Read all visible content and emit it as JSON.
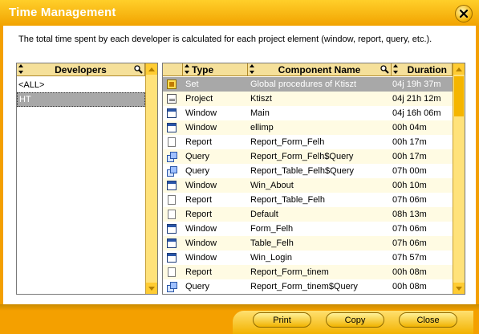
{
  "window": {
    "title": "Time Management",
    "description": "The total time spent by each developer is calculated for each project element (window, report, query, etc.)."
  },
  "developers": {
    "header": "Developers",
    "items": [
      {
        "label": "<ALL>",
        "selected": false
      },
      {
        "label": "HT",
        "selected": true
      }
    ]
  },
  "grid": {
    "columns": {
      "type": "Type",
      "component": "Component Name",
      "duration": "Duration"
    },
    "rows": [
      {
        "icon": "set-icon",
        "type": "Set",
        "component": "Global procedures of Ktiszt",
        "duration": "04j 19h 37m",
        "selected": true
      },
      {
        "icon": "project-icon",
        "type": "Project",
        "component": "Ktiszt",
        "duration": "04j 21h 12m"
      },
      {
        "icon": "window-icon",
        "type": "Window",
        "component": "Main",
        "duration": "04j 16h 06m"
      },
      {
        "icon": "window-icon",
        "type": "Window",
        "component": "ellimp",
        "duration": "00h 04m"
      },
      {
        "icon": "report-icon",
        "type": "Report",
        "component": "Report_Form_Felh",
        "duration": "00h 17m"
      },
      {
        "icon": "query-icon",
        "type": "Query",
        "component": "Report_Form_Felh$Query",
        "duration": "00h 17m"
      },
      {
        "icon": "query-icon",
        "type": "Query",
        "component": "Report_Table_Felh$Query",
        "duration": "07h 00m"
      },
      {
        "icon": "window-icon",
        "type": "Window",
        "component": "Win_About",
        "duration": "00h 10m"
      },
      {
        "icon": "report-icon",
        "type": "Report",
        "component": "Report_Table_Felh",
        "duration": "07h 06m"
      },
      {
        "icon": "report-icon",
        "type": "Report",
        "component": "Default",
        "duration": "08h 13m"
      },
      {
        "icon": "window-icon",
        "type": "Window",
        "component": "Form_Felh",
        "duration": "07h 06m"
      },
      {
        "icon": "window-icon",
        "type": "Window",
        "component": "Table_Felh",
        "duration": "07h 06m"
      },
      {
        "icon": "window-icon",
        "type": "Window",
        "component": "Win_Login",
        "duration": "07h 57m"
      },
      {
        "icon": "report-icon",
        "type": "Report",
        "component": "Report_Form_tinem",
        "duration": "00h 08m"
      },
      {
        "icon": "query-icon",
        "type": "Query",
        "component": "Report_Form_tinem$Query",
        "duration": "00h 08m"
      }
    ]
  },
  "buttons": {
    "print": "Print",
    "copy": "Copy",
    "close": "Close"
  }
}
